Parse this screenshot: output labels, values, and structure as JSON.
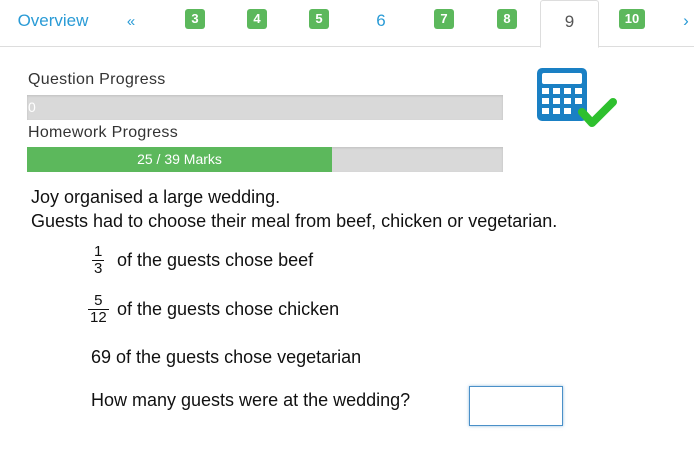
{
  "tabs": {
    "overview": "Overview",
    "prev": "«",
    "items": [
      "3",
      "4",
      "5",
      "6",
      "7",
      "8",
      "9",
      "10"
    ],
    "next": "›"
  },
  "progress": {
    "question_label": "Question Progress",
    "question_text": "0",
    "question_fraction": 0,
    "homework_label": "Homework Progress",
    "homework_text": "25 / 39 Marks",
    "homework_fraction": 0.641
  },
  "calculator": {
    "icon": "calculator-check-icon",
    "color": "#1a80c4",
    "check_color": "#2ec02e"
  },
  "question": {
    "line1": "Joy organised a large wedding.",
    "line2": "Guests had to choose their meal from beef, chicken or vegetarian.",
    "beef_num": "1",
    "beef_den": "3",
    "beef_text": "of the guests chose beef",
    "chicken_num": "5",
    "chicken_den": "12",
    "chicken_text": "of the guests chose chicken",
    "vegetarian_text": "69 of the guests chose vegetarian",
    "prompt": "How many guests were at the wedding?",
    "answer_value": ""
  },
  "colors": {
    "accent": "#2a9bd6",
    "success": "#5cb85c",
    "bar_bg": "#d9d9d9"
  }
}
